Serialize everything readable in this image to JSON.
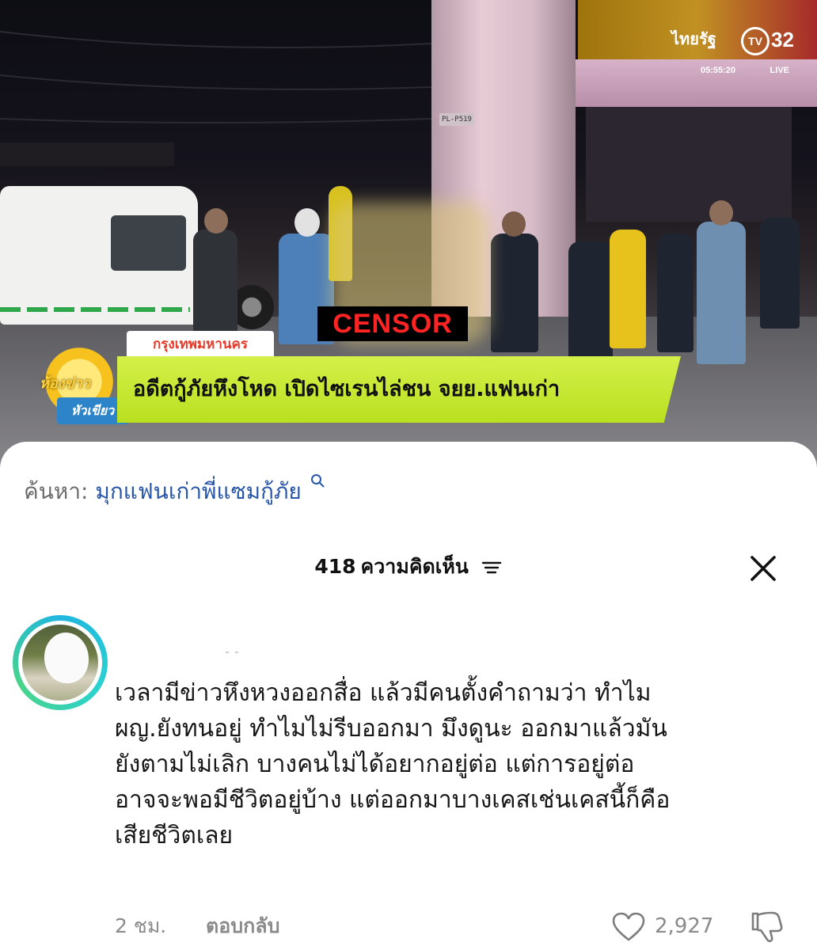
{
  "video": {
    "censor_label": "CENSOR",
    "channel_brand": "ไทยรัฐ",
    "channel_badge": "TV",
    "channel_number": "32",
    "timestamp": "05:55:20",
    "live_label": "LIVE",
    "pillar_tag": "PL-P519",
    "location_label": "กรุงเทพมหานคร",
    "headline": "อดีตกู้ภัยหึงโหด เปิดไซเรนไล่ชน จยย.แฟนเก่า",
    "show_logo_line1": "ห้องข่าว",
    "show_logo_line2": "หัวเขียว",
    "colors": {
      "headline_bg": "#c8ea34",
      "location_text": "#e43a2a",
      "censor_text": "#ff2323"
    }
  },
  "search": {
    "prefix": "ค้นหา:",
    "term": "มุกแฟนเก่าพี่แซมกู้ภัย",
    "icon": "search-icon",
    "color": "#2755a8"
  },
  "comments_header": {
    "count": "418",
    "label": "ความคิดเห็น",
    "sort_icon": "sort-icon",
    "close_icon": "close-icon"
  },
  "comment": {
    "avatar_icon": "avatar",
    "lines": [
      "เวลามีข่าวหึงหวงออกสื่อ แล้วมีคนตั้งคำถามว่า ทำไม",
      "ผญ.ยังทนอยู่ ทำไมไม่รีบออกมา มึงดูนะ ออกมาแล้วมัน",
      "ยังตามไม่เลิก บางคนไม่ได้อยากอยู่ต่อ แต่การอยู่ต่อ",
      "อาจจะพอมีชีวิตอยู่บ้าง แต่ออกมาบางเคสเช่นเคสนี้ก็คือ",
      "เสียชีวิตเลย"
    ],
    "time": "2 ชม.",
    "reply_label": "ตอบกลับ",
    "likes": "2,927",
    "like_icon": "heart-icon",
    "dislike_icon": "thumbs-down-icon"
  }
}
